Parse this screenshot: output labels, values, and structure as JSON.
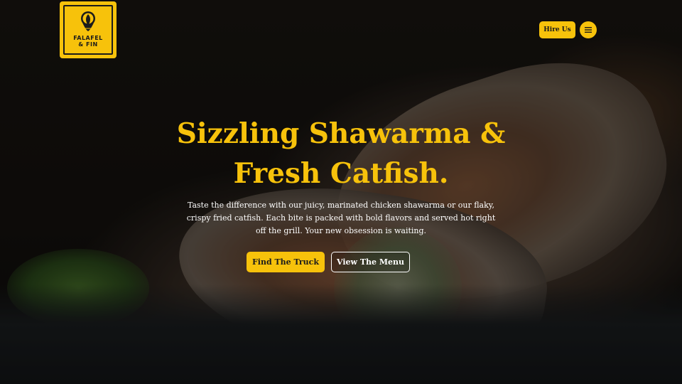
{
  "header": {
    "logo_text_line1": "FALAFEL",
    "logo_text_line2": "& FIN",
    "hire_label": "Hire Us",
    "menu_icon": "hamburger-icon"
  },
  "hero": {
    "title_line1": "Sizzling Shawarma &",
    "title_line2": "Fresh Catfish.",
    "subtitle": "Taste the difference with our juicy, marinated chicken shawarma or our flaky, crispy fried catfish. Each bite is packed with bold flavors and served hot right off the grill. Your new obsession is waiting.",
    "primary_cta": "Find The Truck",
    "secondary_cta": "View The Menu"
  },
  "colors": {
    "accent": "#f7c20b",
    "text_dark": "#1b1b1b",
    "text_light": "#ffffff"
  }
}
